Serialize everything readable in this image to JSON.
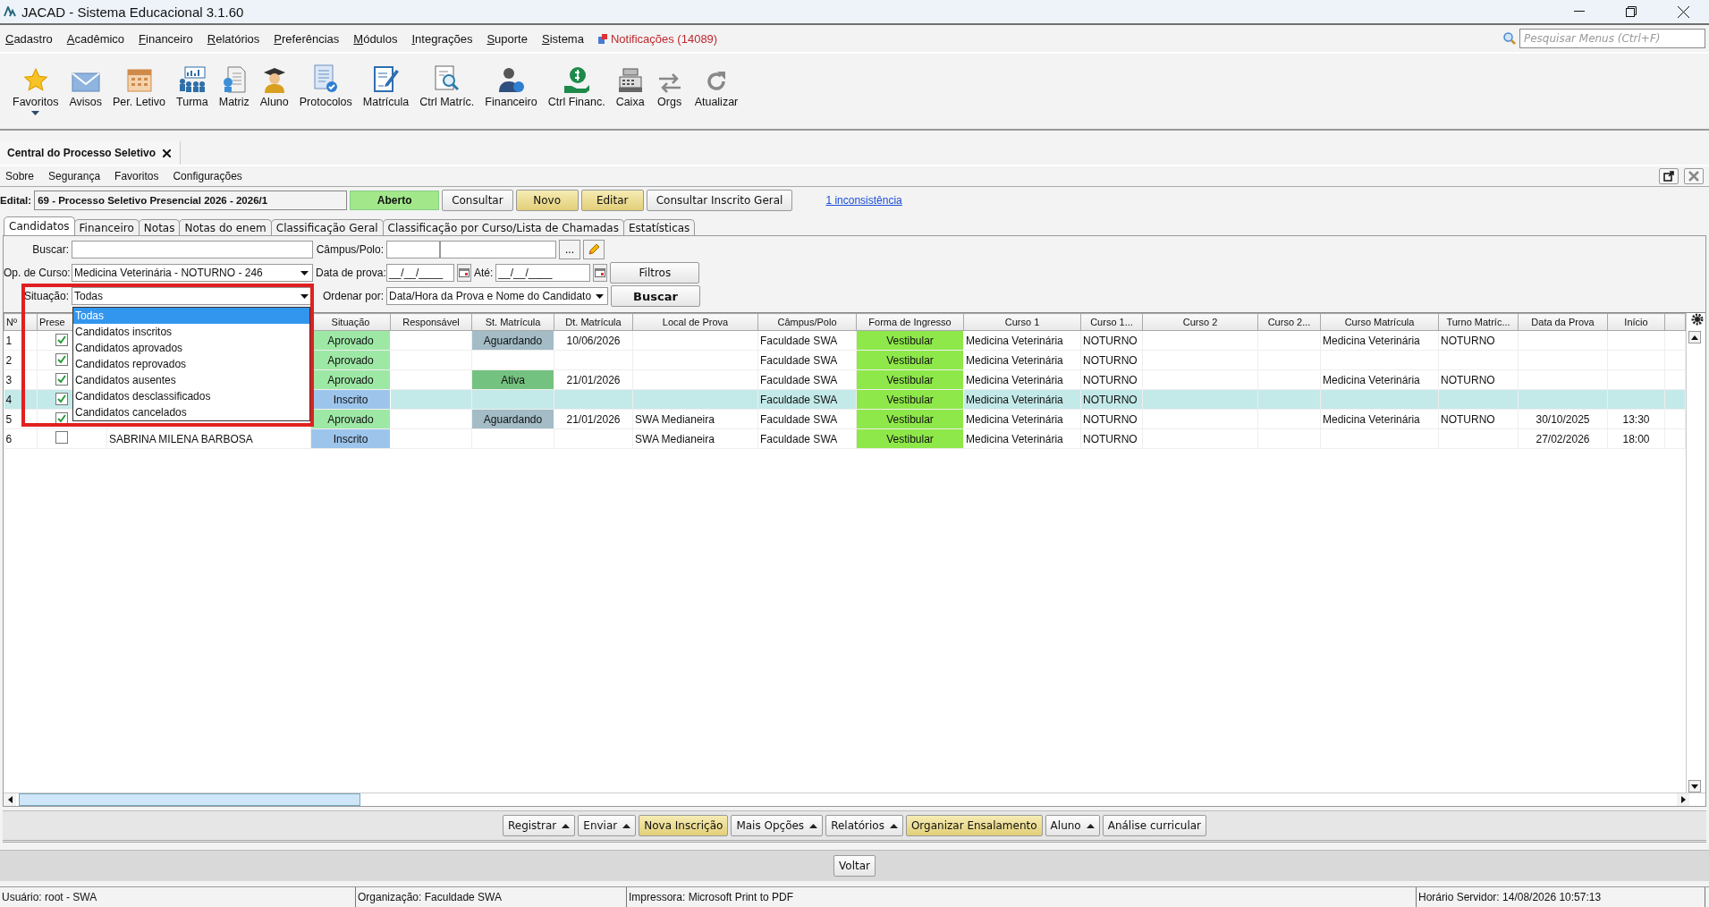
{
  "window": {
    "title": "JACAD - Sistema Educacional 3.1.60"
  },
  "menu": [
    "Cadastro",
    "Acadêmico",
    "Financeiro",
    "Relatórios",
    "Preferências",
    "Módulos",
    "Integrações",
    "Suporte",
    "Sistema"
  ],
  "notifications": "Notificações (14089)",
  "menu_search": {
    "placeholder": "Pesquisar Menus (Ctrl+F)"
  },
  "toolbar": [
    {
      "label": "Favoritos",
      "dropdown": true
    },
    {
      "label": "Avisos"
    },
    {
      "label": "Per. Letivo"
    },
    {
      "label": "Turma"
    },
    {
      "label": "Matriz"
    },
    {
      "label": "Aluno"
    },
    {
      "label": "Protocolos"
    },
    {
      "label": "Matrícula"
    },
    {
      "label": "Ctrl Matríc."
    },
    {
      "label": "Financeiro"
    },
    {
      "label": "Ctrl Financ."
    },
    {
      "label": "Caixa"
    },
    {
      "label": "Orgs"
    },
    {
      "label": "Atualizar"
    }
  ],
  "doc_tab": {
    "title": "Central do Processo Seletivo"
  },
  "submenu": [
    "Sobre",
    "Segurança",
    "Favoritos",
    "Configurações"
  ],
  "edital": {
    "label": "Edital:",
    "value": "69 - Processo Seletivo Presencial 2026 - 2026/1",
    "status": "Aberto"
  },
  "edital_buttons": [
    {
      "label": "Consultar",
      "kind": "normal"
    },
    {
      "label": "Novo",
      "kind": "highlight"
    },
    {
      "label": "Editar",
      "kind": "highlight"
    },
    {
      "label": "Consultar Inscrito Geral",
      "kind": "normal"
    }
  ],
  "inconsistency_link": "1 inconsistência",
  "tabs": [
    {
      "label": "Candidatos",
      "selected": true
    },
    {
      "label": "Financeiro",
      "selected": false
    },
    {
      "label": "Notas",
      "selected": false
    },
    {
      "label": "Notas do enem",
      "selected": false
    },
    {
      "label": "Classificação Geral",
      "selected": false
    },
    {
      "label": "Classificação por Curso/Lista de Chamadas",
      "selected": false
    },
    {
      "label": "Estatísticas",
      "selected": false
    }
  ],
  "filters": {
    "buscar_label": "Buscar:",
    "campus_label": "Câmpus/Polo:",
    "campus_button": "...",
    "curso_label": "Op. de Curso:",
    "curso_value": "Medicina Veterinária - NOTURNO - 246",
    "data_label": "Data de prova:",
    "data_value": "__/__/____",
    "ate_label": "Até:",
    "ate_value": "__/__/____",
    "filtros_button": "Filtros",
    "situacao_label": "Situação:",
    "situacao_value": "Todas",
    "ordenar_label": "Ordenar por:",
    "ordenar_value": "Data/Hora da Prova e Nome do Candidato",
    "buscar_button": "Buscar"
  },
  "situacao_dropdown": [
    {
      "label": "Todas",
      "selected": true
    },
    {
      "label": "Candidatos inscritos",
      "selected": false
    },
    {
      "label": "Candidatos aprovados",
      "selected": false
    },
    {
      "label": "Candidatos reprovados",
      "selected": false
    },
    {
      "label": "Candidatos ausentes",
      "selected": false
    },
    {
      "label": "Candidatos desclassificados",
      "selected": false
    },
    {
      "label": "Candidatos cancelados",
      "selected": false
    }
  ],
  "table": {
    "columns": [
      {
        "label": "Nº"
      },
      {
        "label": "Prese"
      },
      {},
      {
        "label": "Situação"
      },
      {
        "label": "Responsável"
      },
      {
        "label": "St. Matrícula"
      },
      {
        "label": "Dt. Matrícula"
      },
      {
        "label": "Local de Prova"
      },
      {
        "label": "Câmpus/Polo"
      },
      {
        "label": "Forma de Ingresso"
      },
      {
        "label": "Curso 1"
      },
      {
        "label": "Curso 1..."
      },
      {
        "label": "Curso 2"
      },
      {
        "label": "Curso 2..."
      },
      {
        "label": "Curso Matrícula"
      },
      {
        "label": "Turno Matríc..."
      },
      {
        "label": "Data da Prova"
      },
      {
        "label": "Início"
      },
      {}
    ],
    "rows": [
      {
        "n": "1",
        "present": true,
        "selected": false,
        "situacao": {
          "text": "Aprovado",
          "color": "#9ee8a6"
        },
        "st_matricula": {
          "text": "Aguardando",
          "color": "#a3bcc6"
        },
        "dt_matricula": "10/06/2026",
        "campus": "Faculdade SWA",
        "forma": {
          "text": "Vestibular",
          "color": "#8ee84a"
        },
        "curso1": "Medicina Veterinária",
        "curso1_turno": "NOTURNO",
        "curso_matricula": "Medicina Veterinária",
        "turno_matricula": "NOTURNO"
      },
      {
        "n": "2",
        "present": true,
        "selected": false,
        "situacao": {
          "text": "Aprovado",
          "color": "#9ee8a6"
        },
        "campus": "Faculdade SWA",
        "forma": {
          "text": "Vestibular",
          "color": "#8ee84a"
        },
        "curso1": "Medicina Veterinária",
        "curso1_turno": "NOTURNO"
      },
      {
        "n": "3",
        "present": true,
        "selected": false,
        "situacao": {
          "text": "Aprovado",
          "color": "#9ee8a6"
        },
        "st_matricula": {
          "text": "Ativa",
          "color": "#74c27f"
        },
        "dt_matricula": "21/01/2026",
        "campus": "Faculdade SWA",
        "forma": {
          "text": "Vestibular",
          "color": "#8ee84a"
        },
        "curso1": "Medicina Veterinária",
        "curso1_turno": "NOTURNO",
        "curso_matricula": "Medicina Veterinária",
        "turno_matricula": "NOTURNO"
      },
      {
        "n": "4",
        "present": true,
        "selected": true,
        "situacao": {
          "text": "Inscrito",
          "color": "#9dc5ec"
        },
        "campus": "Faculdade SWA",
        "forma": {
          "text": "Vestibular",
          "color": "#8ee84a"
        },
        "curso1": "Medicina Veterinária",
        "curso1_turno": "NOTURNO"
      },
      {
        "n": "5",
        "present": true,
        "selected": false,
        "situacao": {
          "text": "Aprovado",
          "color": "#9ee8a6"
        },
        "st_matricula": {
          "text": "Aguardando",
          "color": "#a3bcc6"
        },
        "dt_matricula": "21/01/2026",
        "local_prova": "SWA Medianeira",
        "campus": "Faculdade SWA",
        "forma": {
          "text": "Vestibular",
          "color": "#8ee84a"
        },
        "curso1": "Medicina Veterinária",
        "curso1_turno": "NOTURNO",
        "curso_matricula": "Medicina Veterinária",
        "turno_matricula": "NOTURNO",
        "data_prova": "30/10/2025",
        "inicio": "13:30"
      },
      {
        "n": "6",
        "present": false,
        "selected": false,
        "name": "SABRINA MILENA BARBOSA",
        "situacao": {
          "text": "Inscrito",
          "color": "#9dc5ec"
        },
        "local_prova": "SWA Medianeira",
        "campus": "Faculdade SWA",
        "forma": {
          "text": "Vestibular",
          "color": "#8ee84a"
        },
        "curso1": "Medicina Veterinária",
        "curso1_turno": "NOTURNO",
        "data_prova": "27/02/2026",
        "inicio": "18:00"
      }
    ]
  },
  "bottom_buttons": [
    {
      "label": "Registrar",
      "menu": true,
      "kind": "normal"
    },
    {
      "label": "Enviar",
      "menu": true,
      "kind": "normal"
    },
    {
      "label": "Nova Inscrição",
      "menu": false,
      "kind": "highlight"
    },
    {
      "label": "Mais Opções",
      "menu": true,
      "kind": "normal"
    },
    {
      "label": "Relatórios",
      "menu": true,
      "kind": "normal"
    },
    {
      "label": "Organizar Ensalamento",
      "menu": false,
      "kind": "highlight"
    },
    {
      "label": "Aluno",
      "menu": true,
      "kind": "normal"
    },
    {
      "label": "Análise curricular",
      "menu": false,
      "kind": "normal"
    }
  ],
  "back_button": "Voltar",
  "status_bar": [
    "Usuário: root - SWA",
    "Organização: Faculdade SWA",
    "Impressora: Microsoft Print to PDF",
    "Horário Servidor: 14/08/2026 10:57:13"
  ]
}
